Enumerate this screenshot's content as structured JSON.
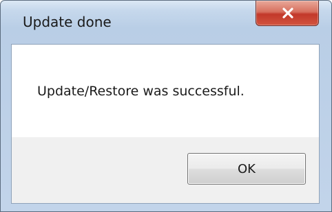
{
  "window": {
    "title": "Update done",
    "close_icon": "close-x-icon"
  },
  "dialog": {
    "message": "Update/Restore was successful.",
    "ok_label": "OK"
  },
  "colors": {
    "close_button": "#c2382a",
    "frame": "#b9cee6",
    "button_bar": "#f0f0f0"
  }
}
